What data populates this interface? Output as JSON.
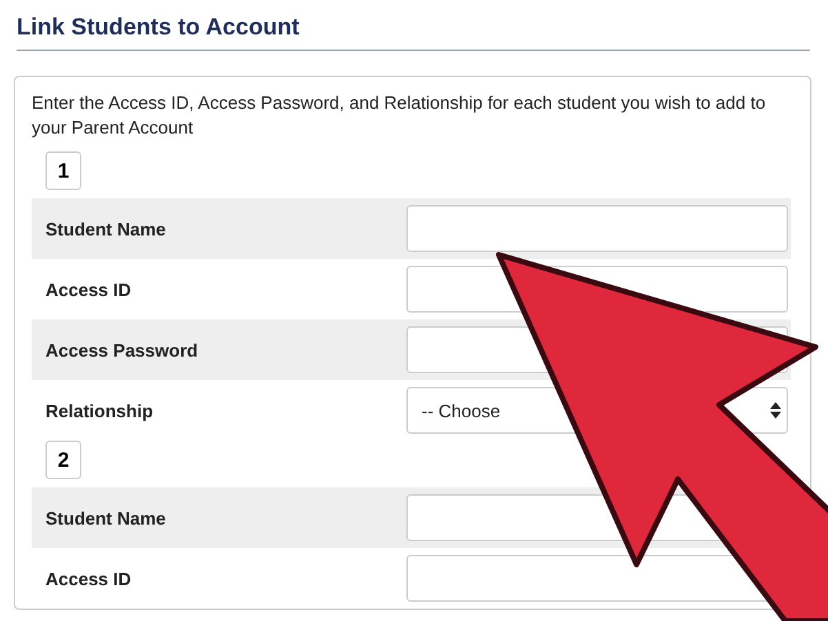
{
  "title": "Link Students to Account",
  "instructions": "Enter the Access ID, Access Password, and Relationship for each student you wish to add to your Parent Account",
  "students": [
    {
      "number": "1",
      "fields": [
        {
          "label": "Student Name",
          "kind": "text"
        },
        {
          "label": "Access ID",
          "kind": "text"
        },
        {
          "label": "Access Password",
          "kind": "text"
        },
        {
          "label": "Relationship",
          "kind": "select",
          "value": "-- Choose"
        }
      ]
    },
    {
      "number": "2",
      "fields": [
        {
          "label": "Student Name",
          "kind": "text"
        },
        {
          "label": "Access ID",
          "kind": "text"
        }
      ]
    }
  ]
}
